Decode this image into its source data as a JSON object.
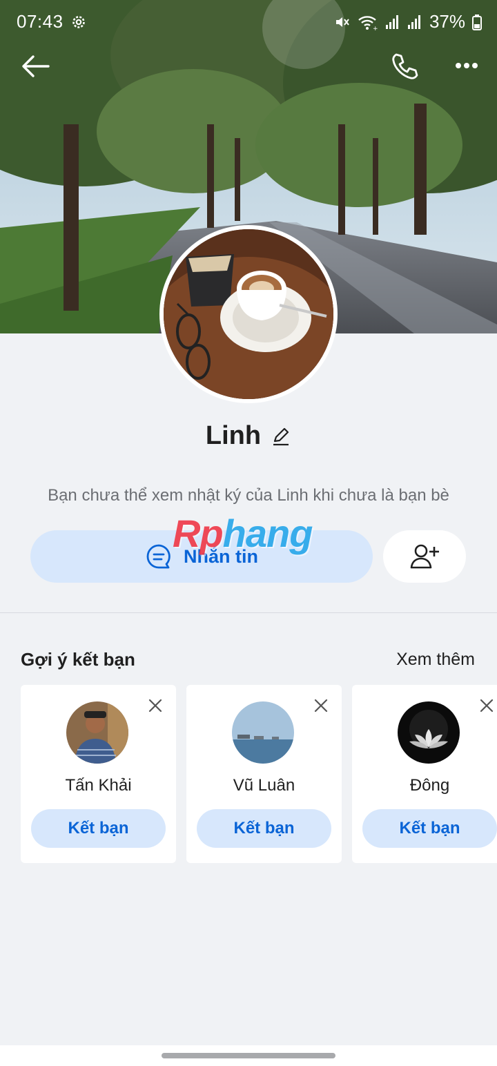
{
  "status_bar": {
    "time": "07:43",
    "battery": "37%",
    "icons": [
      "gear-icon",
      "mute-icon",
      "wifi-icon",
      "signal-icon",
      "signal-icon",
      "battery-icon"
    ]
  },
  "top_bar": {
    "icons": [
      "back-arrow-icon",
      "phone-icon",
      "more-icon"
    ]
  },
  "profile": {
    "name": "Linh",
    "notice": "Bạn chưa thể xem nhật ký của Linh khi chưa là bạn bè",
    "message_button": "Nhắn tin"
  },
  "watermark": {
    "head": "Rp",
    "tail": "hang"
  },
  "suggestions": {
    "title": "Gợi ý kết bạn",
    "see_more": "Xem thêm",
    "items": [
      {
        "name": "Tấn Khải",
        "button": "Kết bạn"
      },
      {
        "name": "Vũ Luân",
        "button": "Kết bạn"
      },
      {
        "name": "Đông",
        "button": "Kết bạn"
      }
    ]
  },
  "colors": {
    "accent": "#0a64d6",
    "button_bg": "#d7e7fc",
    "page_bg": "#f0f2f5"
  }
}
